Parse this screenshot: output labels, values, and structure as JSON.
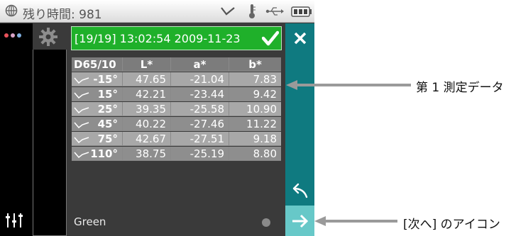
{
  "status_bar": {
    "remaining_label": "残り時間: 981",
    "icons": [
      "globe-icon",
      "check-chevron-icon",
      "thermometer-icon",
      "usb-icon",
      "battery-icon"
    ]
  },
  "header": {
    "text": "[19/19] 13:02:54 2009-11-23",
    "status_icon": "checkmark-icon",
    "color": "#1fb02a"
  },
  "table": {
    "columns": [
      "D65/10",
      "L*",
      "a*",
      "b*"
    ],
    "rows": [
      {
        "angle": "-15°",
        "L": "47.65",
        "a": "-21.04",
        "b": "7.83"
      },
      {
        "angle": "15°",
        "L": "42.21",
        "a": "-23.44",
        "b": "9.42"
      },
      {
        "angle": "25°",
        "L": "39.35",
        "a": "-25.58",
        "b": "10.90"
      },
      {
        "angle": "45°",
        "L": "40.22",
        "a": "-27.46",
        "b": "11.22"
      },
      {
        "angle": "75°",
        "L": "42.67",
        "a": "-27.51",
        "b": "9.18"
      },
      {
        "angle": "110°",
        "L": "38.75",
        "a": "-25.19",
        "b": "8.80"
      }
    ]
  },
  "sample_name": "Green",
  "sidebar": {
    "top_icons": [
      "color-dots-icon",
      "gear-icon"
    ],
    "bottom_icon": "sliders-icon"
  },
  "right_panel": {
    "close_icon": "close-icon",
    "back_icon": "back-arrow-icon",
    "next_icon": "next-arrow-icon",
    "color": "#0f7a80",
    "next_color": "#67c8c8"
  },
  "annotations": {
    "first_measurement": "第 1 測定データ",
    "next_icon": "[次へ] のアイコン"
  }
}
